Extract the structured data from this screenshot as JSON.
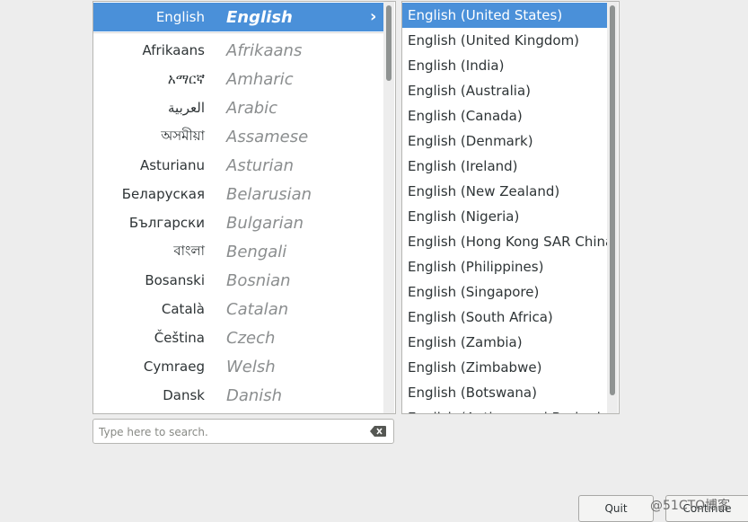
{
  "languages": [
    {
      "native": "English",
      "english": "English",
      "selected": true
    },
    {
      "native": "Afrikaans",
      "english": "Afrikaans"
    },
    {
      "native": "አማርኛ",
      "english": "Amharic"
    },
    {
      "native": "العربية",
      "english": "Arabic"
    },
    {
      "native": "অসমীয়া",
      "english": "Assamese"
    },
    {
      "native": "Asturianu",
      "english": "Asturian"
    },
    {
      "native": "Беларуская",
      "english": "Belarusian"
    },
    {
      "native": "Български",
      "english": "Bulgarian"
    },
    {
      "native": "বাংলা",
      "english": "Bengali"
    },
    {
      "native": "Bosanski",
      "english": "Bosnian"
    },
    {
      "native": "Català",
      "english": "Catalan"
    },
    {
      "native": "Čeština",
      "english": "Czech"
    },
    {
      "native": "Cymraeg",
      "english": "Welsh"
    },
    {
      "native": "Dansk",
      "english": "Danish"
    }
  ],
  "locales": [
    {
      "label": "English (United States)",
      "selected": true
    },
    {
      "label": "English (United Kingdom)"
    },
    {
      "label": "English (India)"
    },
    {
      "label": "English (Australia)"
    },
    {
      "label": "English (Canada)"
    },
    {
      "label": "English (Denmark)"
    },
    {
      "label": "English (Ireland)"
    },
    {
      "label": "English (New Zealand)"
    },
    {
      "label": "English (Nigeria)"
    },
    {
      "label": "English (Hong Kong SAR China)"
    },
    {
      "label": "English (Philippines)"
    },
    {
      "label": "English (Singapore)"
    },
    {
      "label": "English (South Africa)"
    },
    {
      "label": "English (Zambia)"
    },
    {
      "label": "English (Zimbabwe)"
    },
    {
      "label": "English (Botswana)"
    },
    {
      "label": "English (Antigua and Barbuda)"
    }
  ],
  "search": {
    "placeholder": "Type here to search.",
    "value": ""
  },
  "buttons": {
    "quit": "Quit",
    "continue": "Continue"
  },
  "watermark": "@51CTO博客",
  "colors": {
    "accent": "#4a90d9",
    "background": "#ededed"
  },
  "icons": {
    "chevron": "chevron-right-icon",
    "clear": "backspace-clear-icon"
  }
}
